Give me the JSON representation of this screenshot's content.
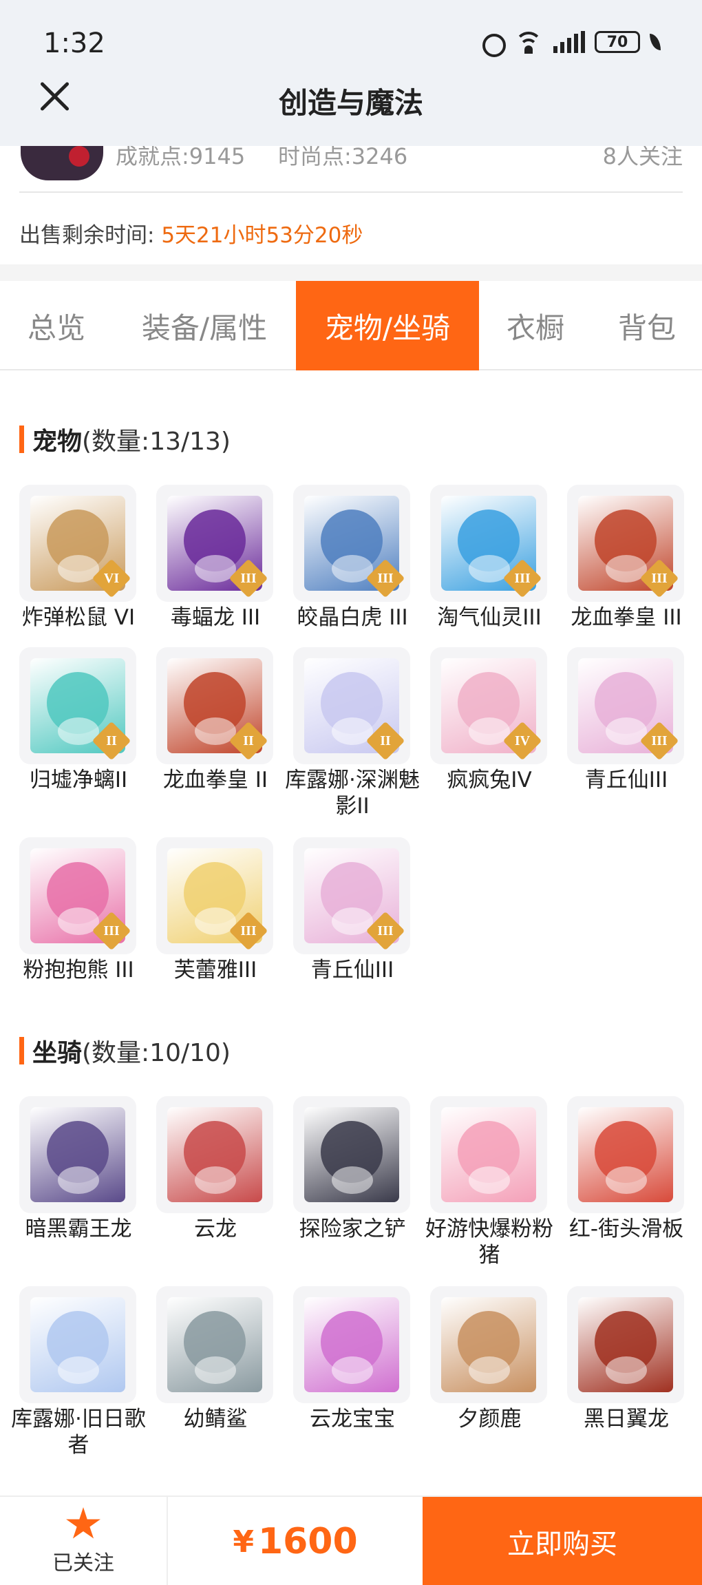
{
  "status_bar": {
    "time": "1:32",
    "battery": "70"
  },
  "header": {
    "title": "创造与魔法"
  },
  "seller": {
    "achievement": "成就点:9145",
    "time_points": "时尚点:3246",
    "followers": "8人关注"
  },
  "sale": {
    "label": "出售剩余时间:",
    "remaining": "5天21小时53分20秒"
  },
  "tabs": [
    {
      "label": "总览",
      "active": false
    },
    {
      "label": "装备/属性",
      "active": false
    },
    {
      "label": "宠物/坐骑",
      "active": true
    },
    {
      "label": "衣橱",
      "active": false
    },
    {
      "label": "背包",
      "active": false
    }
  ],
  "pets": {
    "title": "宠物",
    "count": "(数量:13/13)",
    "items": [
      {
        "name": "炸弹松鼠 VI",
        "badge": "VI",
        "color": "#c99a5c"
      },
      {
        "name": "毒蝠龙 III",
        "badge": "III",
        "color": "#6a2a9a"
      },
      {
        "name": "皎晶白虎 III",
        "badge": "III",
        "color": "#4f7fc0"
      },
      {
        "name": "淘气仙灵III",
        "badge": "III",
        "color": "#3aa0e0"
      },
      {
        "name": "龙血拳皇 III",
        "badge": "III",
        "color": "#c0442a"
      },
      {
        "name": "归墟净螭II",
        "badge": "II",
        "color": "#50c8c0"
      },
      {
        "name": "龙血拳皇 II",
        "badge": "II",
        "color": "#c0442a"
      },
      {
        "name": "库露娜·深渊魅影II",
        "badge": "II",
        "color": "#c8c8f0"
      },
      {
        "name": "疯疯兔IV",
        "badge": "IV",
        "color": "#f0b0c8"
      },
      {
        "name": "青丘仙III",
        "badge": "III",
        "color": "#e8b0d8"
      },
      {
        "name": "粉抱抱熊 III",
        "badge": "III",
        "color": "#e870a8"
      },
      {
        "name": "芙蕾雅III",
        "badge": "III",
        "color": "#f0d070"
      },
      {
        "name": "青丘仙III",
        "badge": "III",
        "color": "#e8b0d8"
      }
    ]
  },
  "mounts": {
    "title": "坐骑",
    "count": "(数量:10/10)",
    "items": [
      {
        "name": "暗黑霸王龙",
        "color": "#5a4a8a"
      },
      {
        "name": "云龙",
        "color": "#c84a4a"
      },
      {
        "name": "探险家之铲",
        "color": "#3a3a4a"
      },
      {
        "name": "好游快爆粉粉猪",
        "color": "#f4a0b8"
      },
      {
        "name": "红-街头滑板",
        "color": "#d84a3a"
      },
      {
        "name": "库露娜·旧日歌者",
        "color": "#b0c8f0"
      },
      {
        "name": "幼鲭鲨",
        "color": "#8a9aa0"
      },
      {
        "name": "云龙宝宝",
        "color": "#d070d0"
      },
      {
        "name": "夕颜鹿",
        "color": "#c89060"
      },
      {
        "name": "黑日翼龙",
        "color": "#a03020"
      }
    ]
  },
  "bottom": {
    "follow_label": "已关注",
    "price_symbol": "¥",
    "price": "1600",
    "buy_label": "立即购买"
  }
}
